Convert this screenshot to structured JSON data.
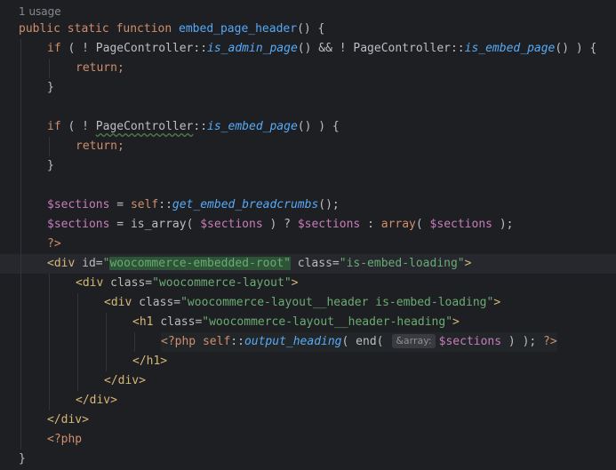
{
  "usage_hint": "1 usage",
  "param_hint": "&array:",
  "colors": {
    "background": "#1e1f22",
    "keyword": "#cf8e6d",
    "function": "#56a8f5",
    "static_call": "#57aaf7",
    "variable": "#c77dbb",
    "tag": "#d5b778",
    "string": "#6aab73",
    "current_line": "#26282e"
  },
  "code": {
    "l1": {
      "kw": "public static function ",
      "name": "embed_page_header",
      "rest": "() {"
    },
    "l2": {
      "a": "if",
      "b": " ( ! PageController::",
      "c": "is_admin_page",
      "d": "() && ! PageController::",
      "e": "is_embed_page",
      "f": "() ) {"
    },
    "l3": {
      "kw": "return",
      "rest": ";"
    },
    "l4": {
      "text": "}"
    },
    "l5": {
      "a": "if",
      "b": " ( ! ",
      "cls": "PageController",
      "sep": "::",
      "c": "is_embed_page",
      "d": "() ) {"
    },
    "l6": {
      "kw": "return",
      "rest": ";"
    },
    "l7": {
      "text": "}"
    },
    "l8": {
      "var": "$sections",
      "eq": " = ",
      "self": "self",
      "sep": "::",
      "fn": "get_embed_breadcrumbs",
      "end": "();"
    },
    "l9": {
      "var1": "$sections",
      "eq": " = ",
      "fn": "is_array",
      "p1": "( ",
      "var2": "$sections",
      "p2": " ) ? ",
      "var3": "$sections",
      "p3": " : ",
      "kw": "array",
      "p4": "( ",
      "var4": "$sections",
      "p5": " );"
    },
    "l10": {
      "text": "?>"
    },
    "l11": {
      "open": "<div ",
      "attr1": "id=",
      "q1": "\"",
      "val1": "woocommerce-embedded-root",
      "q2": "\"",
      "sp": " ",
      "attr2": "class=",
      "val2": "\"is-embed-loading\"",
      "close": ">"
    },
    "l12": {
      "open": "<div ",
      "attr": "class=",
      "val": "\"woocommerce-layout\"",
      "close": ">"
    },
    "l13": {
      "open": "<div ",
      "attr": "class=",
      "val": "\"woocommerce-layout__header is-embed-loading\"",
      "close": ">"
    },
    "l14": {
      "open": "<h1 ",
      "attr": "class=",
      "val": "\"woocommerce-layout__header-heading\"",
      "close": ">"
    },
    "l15": {
      "open": "<?php ",
      "self": "self",
      "sep": "::",
      "fn": "output_heading",
      "p1": "( ",
      "end_fn": "end",
      "p2": "( ",
      "var": "$sections",
      "p3": " ) );",
      "close": " ?>"
    },
    "l16": {
      "text": "</h1>"
    },
    "l17": {
      "text": "</div>"
    },
    "l18": {
      "text": "</div>"
    },
    "l19": {
      "text": "</div>"
    },
    "l20": {
      "text": "<?php"
    },
    "l21": {
      "text": "}"
    }
  }
}
